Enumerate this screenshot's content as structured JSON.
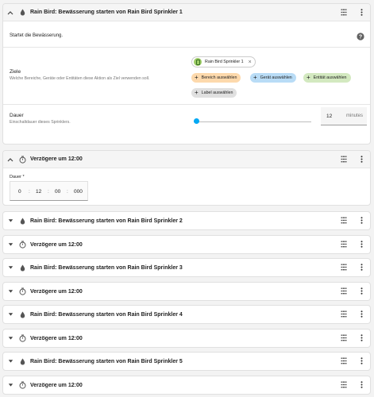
{
  "action1": {
    "title": "Rain Bird: Bewässerung starten von Rain Bird Sprinkler 1",
    "description": "Startet die Bewässerung.",
    "targets_label": "Ziele",
    "targets_sub": "Welche Bereiche, Geräte oder Entitäten diese Aktion als Ziel verwenden soll.",
    "device_chip": "Rain Bird Sprinkler 1",
    "chips": {
      "area": "Bereich auswählen",
      "device": "Gerät auswählen",
      "entity": "Entität auswählen",
      "label": "Label auswählen"
    },
    "duration_label": "Dauer",
    "duration_sub": "Einschaltdauer dieses Sprinklers.",
    "duration_value": "12",
    "duration_unit": "minutes",
    "slider_fraction": 0.0
  },
  "delay1": {
    "title": "Verzögere um 12:00",
    "field_label": "Dauer *",
    "hours": "0",
    "minutes": "12",
    "seconds": "00",
    "millis": "000",
    "sep": ":"
  },
  "collapsed": [
    {
      "type": "rain",
      "title": "Rain Bird: Bewässerung starten von Rain Bird Sprinkler 2"
    },
    {
      "type": "delay",
      "title": "Verzögere um 12:00"
    },
    {
      "type": "rain",
      "title": "Rain Bird: Bewässerung starten von Rain Bird Sprinkler 3"
    },
    {
      "type": "delay",
      "title": "Verzögere um 12:00"
    },
    {
      "type": "rain",
      "title": "Rain Bird: Bewässerung starten von Rain Bird Sprinkler 4"
    },
    {
      "type": "delay",
      "title": "Verzögere um 12:00"
    },
    {
      "type": "rain",
      "title": "Rain Bird: Bewässerung starten von Rain Bird Sprinkler 5"
    },
    {
      "type": "delay",
      "title": "Verzögere um 12:00"
    }
  ],
  "colors": {
    "area_chip": "#fdd9ac",
    "device_chip": "#b9dcf6",
    "entity_chip": "#d3e9c0",
    "label_chip": "#e0e0e0",
    "accent": "#03a9f4"
  }
}
